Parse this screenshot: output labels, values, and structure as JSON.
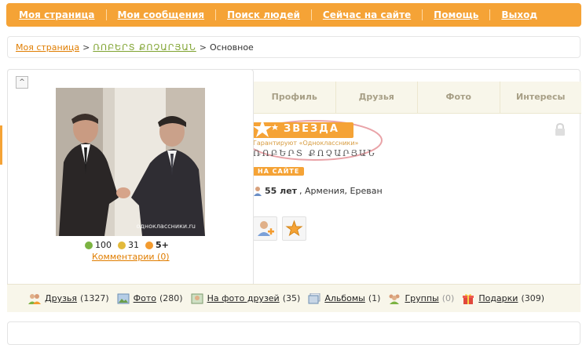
{
  "nav": {
    "items": [
      "Моя страница",
      "Мои сообщения",
      "Поиск людей",
      "Сейчас на сайте",
      "Помощь",
      "Выход"
    ],
    "color": "#f5a336"
  },
  "breadcrumb": {
    "home": "Моя страница",
    "user": "ՌՈԲԵՐՏ ՔՈՉԱՐՅԱՆ",
    "current": "Основное",
    "sep": ">"
  },
  "collapse_symbol": "^",
  "photo": {
    "watermark": "одноклассники.ru"
  },
  "stats": {
    "rating": "100",
    "gifts": "31",
    "stars": "5+"
  },
  "comments_link": "Комментарии (0)",
  "tabs": [
    "Профиль",
    "Друзья",
    "Фото",
    "Интересы"
  ],
  "badge": {
    "title": "ЗВЕЗДА",
    "subtitle": "Гарантируют «Одноклассники»"
  },
  "profile": {
    "name": "ՌՈԲԵՐՏ ՔՈՉԱՐՅԱՆ",
    "online": "НА САЙТЕ",
    "age": "55 лет",
    "location": ", Армения, Ереван"
  },
  "bottom": [
    {
      "label": "Друзья",
      "count": "(1327)",
      "icon": "friends-icon"
    },
    {
      "label": "Фото",
      "count": "(280)",
      "icon": "photo-icon"
    },
    {
      "label": "На фото друзей",
      "count": "(35)",
      "icon": "friends-photo-icon"
    },
    {
      "label": "Альбомы",
      "count": "(1)",
      "icon": "albums-icon"
    },
    {
      "label": "Группы",
      "count": "(0)",
      "icon": "groups-icon"
    },
    {
      "label": "Подарки",
      "count": "(309)",
      "icon": "gift-icon"
    }
  ]
}
